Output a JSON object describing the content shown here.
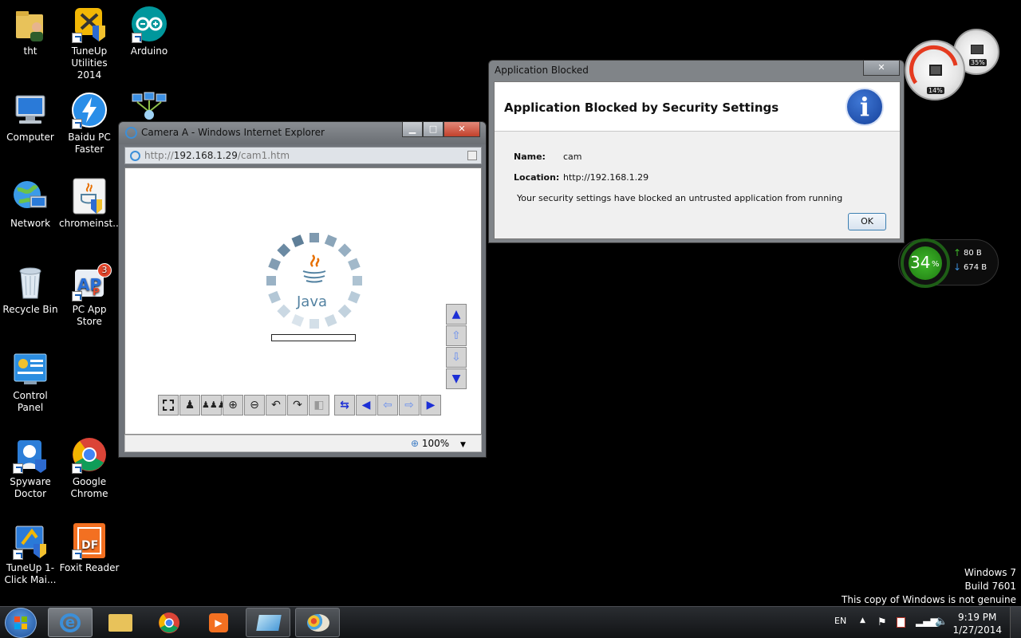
{
  "desktop": {
    "icons": [
      {
        "label": "tht"
      },
      {
        "label": "TuneUp Utilities 2014"
      },
      {
        "label": "Arduino"
      },
      {
        "label": "Computer"
      },
      {
        "label": "Baidu PC Faster"
      },
      {
        "label": "Network"
      },
      {
        "label": "chromeinst..."
      },
      {
        "label": "Recycle Bin"
      },
      {
        "label": "PC App Store",
        "badge": "3"
      },
      {
        "label": "Control Panel"
      },
      {
        "label": "Spyware Doctor"
      },
      {
        "label": "Google Chrome"
      },
      {
        "label": "TuneUp 1-Click Mai..."
      },
      {
        "label": "Foxit Reader"
      }
    ]
  },
  "ie_window": {
    "title": "Camera A - Windows Internet Explorer",
    "url_scheme": "http://",
    "url_host": "192.168.1.29",
    "url_path": "/cam1.htm",
    "java_logo_text": "Java",
    "zoom": "100%",
    "toolbar_icons": [
      "select-area",
      "single-person",
      "group",
      "zoom-in",
      "zoom-out",
      "rotate-left",
      "rotate-right",
      "mirror",
      "swap",
      "left-solid",
      "left-outline",
      "right-outline",
      "right-solid"
    ],
    "side_icons": [
      "up-solid",
      "up-outline",
      "down-outline",
      "down-solid"
    ]
  },
  "dialog": {
    "title": "Application Blocked",
    "heading": "Application Blocked by Security Settings",
    "name_label": "Name:",
    "name_value": "cam",
    "location_label": "Location:",
    "location_value": "http://192.168.1.29",
    "message": "Your security settings have blocked an untrusted application from running",
    "ok_label": "OK",
    "close_label": "✕",
    "info_glyph": "i"
  },
  "gadgets": {
    "cpu_percent": "14%",
    "mem_percent": "35%",
    "net_percent": "34",
    "net_percent_sign": "%",
    "upload": "80 B",
    "download": "674 B"
  },
  "watermark": {
    "line1": "Windows 7",
    "line2": "Build 7601",
    "line3": "This copy of Windows is not genuine"
  },
  "taskbar": {
    "language": "EN",
    "time": "9:19 PM",
    "date": "1/27/2014"
  },
  "colors": {
    "accent_blue": "#1c2fd6",
    "net_green": "#2fa41b"
  }
}
